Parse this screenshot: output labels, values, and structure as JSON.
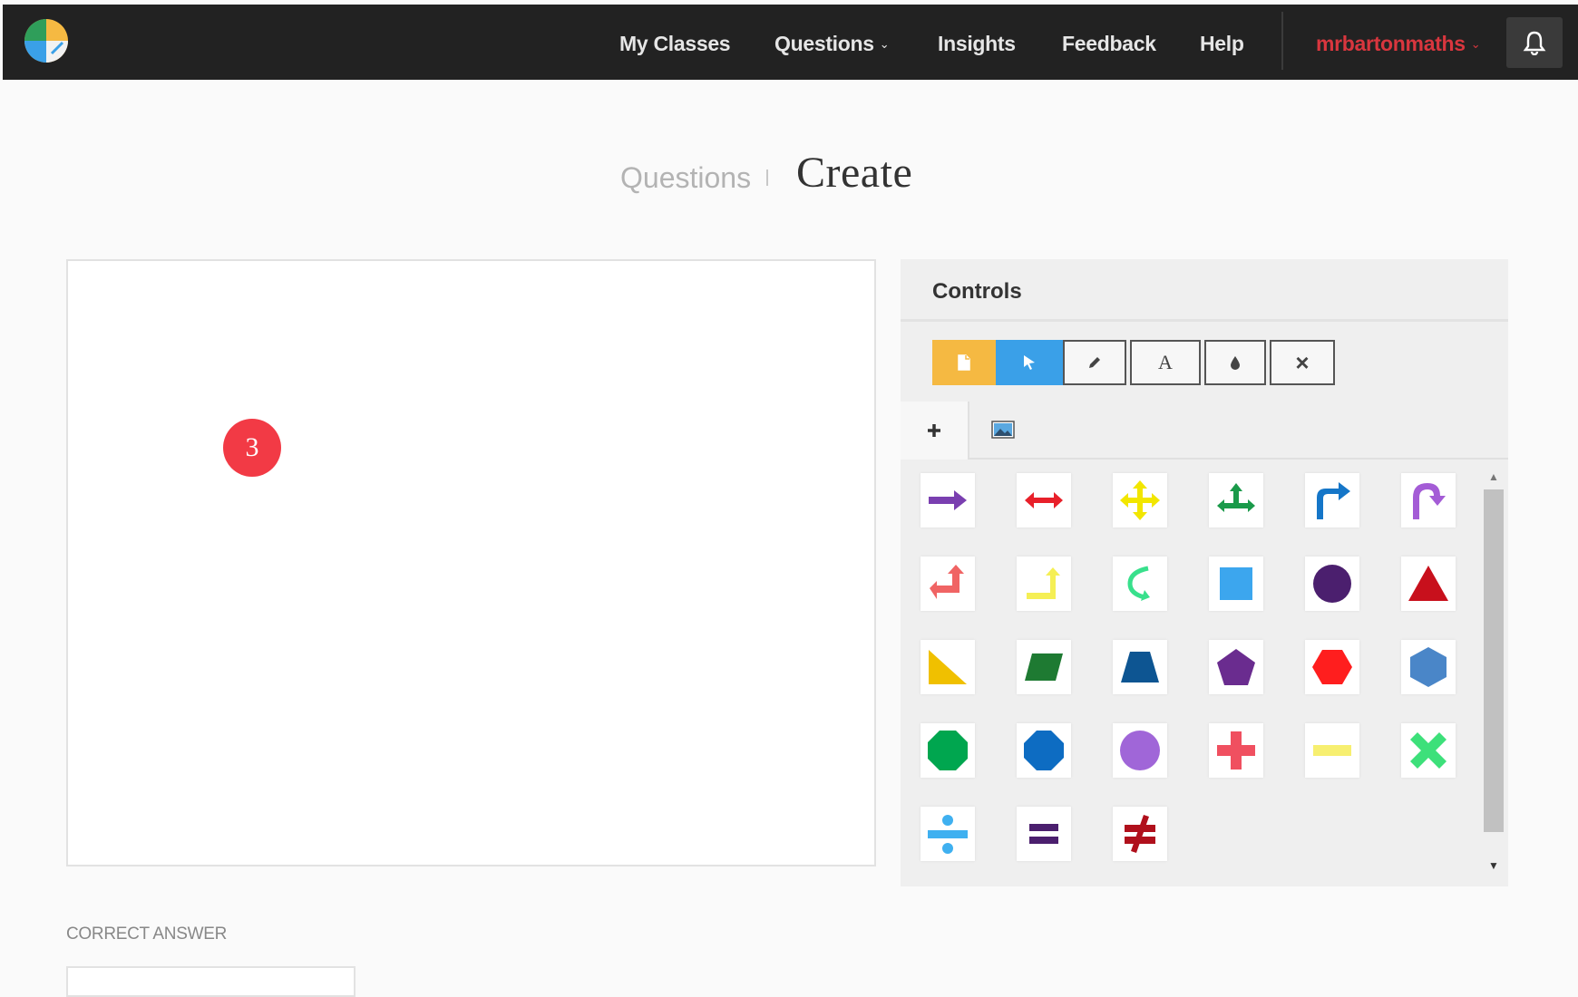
{
  "nav": {
    "items": [
      {
        "label": "My Classes",
        "dropdown": false
      },
      {
        "label": "Questions",
        "dropdown": true
      },
      {
        "label": "Insights",
        "dropdown": false
      },
      {
        "label": "Feedback",
        "dropdown": false
      },
      {
        "label": "Help",
        "dropdown": false
      }
    ],
    "user": "mrbartonmaths",
    "bell_icon": "bell-icon",
    "logo_icon": "app-logo"
  },
  "header": {
    "breadcrumb": "Questions",
    "title": "Create"
  },
  "canvas": {
    "marker_label": "3"
  },
  "controls": {
    "title": "Controls",
    "tools": [
      {
        "name": "new-page",
        "icon": "file-icon",
        "active": false
      },
      {
        "name": "select",
        "icon": "cursor-icon",
        "active": true
      },
      {
        "name": "pencil",
        "icon": "pencil-icon",
        "active": false
      },
      {
        "name": "text",
        "icon": "text-icon",
        "glyph": "A",
        "active": false
      },
      {
        "name": "fill",
        "icon": "ink-drop-icon",
        "active": false
      },
      {
        "name": "delete",
        "icon": "close-icon",
        "glyph": "×",
        "active": false
      }
    ],
    "tabs": [
      {
        "name": "shapes",
        "icon": "plus-icon",
        "active": true
      },
      {
        "name": "images",
        "icon": "image-icon",
        "active": false
      }
    ],
    "shapes": [
      {
        "name": "arrow-right",
        "color": "#7a3fb0"
      },
      {
        "name": "arrow-double",
        "color": "#e8202a"
      },
      {
        "name": "arrow-four-way",
        "color": "#f2e600"
      },
      {
        "name": "arrow-three-way",
        "color": "#1a9a4a"
      },
      {
        "name": "arrow-bent-right",
        "color": "#1576c8"
      },
      {
        "name": "arrow-u-turn",
        "color": "#a45cd6"
      },
      {
        "name": "arrow-corner-up",
        "color": "#f06464"
      },
      {
        "name": "arrow-corner-up-yellow",
        "color": "#f5ef55"
      },
      {
        "name": "arrow-curved",
        "color": "#38e08c"
      },
      {
        "name": "square",
        "color": "#3ca6ee"
      },
      {
        "name": "circle-small",
        "color": "#4b1f6e"
      },
      {
        "name": "triangle",
        "color": "#c8101c"
      },
      {
        "name": "right-triangle",
        "color": "#f0c000"
      },
      {
        "name": "parallelogram",
        "color": "#1e7a32"
      },
      {
        "name": "trapezium",
        "color": "#0d5592"
      },
      {
        "name": "pentagon",
        "color": "#6a2c8f"
      },
      {
        "name": "hexagon",
        "color": "#ff1e1e"
      },
      {
        "name": "hexagon-blue",
        "color": "#4a86c8"
      },
      {
        "name": "octagon",
        "color": "#00a64f"
      },
      {
        "name": "octagon-blue",
        "color": "#0d6cc2"
      },
      {
        "name": "circle",
        "color": "#a066d8"
      },
      {
        "name": "plus-sign",
        "color": "#f05060"
      },
      {
        "name": "minus-sign",
        "color": "#f7ef70"
      },
      {
        "name": "times-sign",
        "color": "#3de07a"
      },
      {
        "name": "divide-sign",
        "color": "#3fb0f0"
      },
      {
        "name": "equals-sign",
        "color": "#4b1f6e"
      },
      {
        "name": "not-equal-sign",
        "color": "#b0101c"
      }
    ]
  },
  "answer": {
    "label": "CORRECT ANSWER"
  }
}
